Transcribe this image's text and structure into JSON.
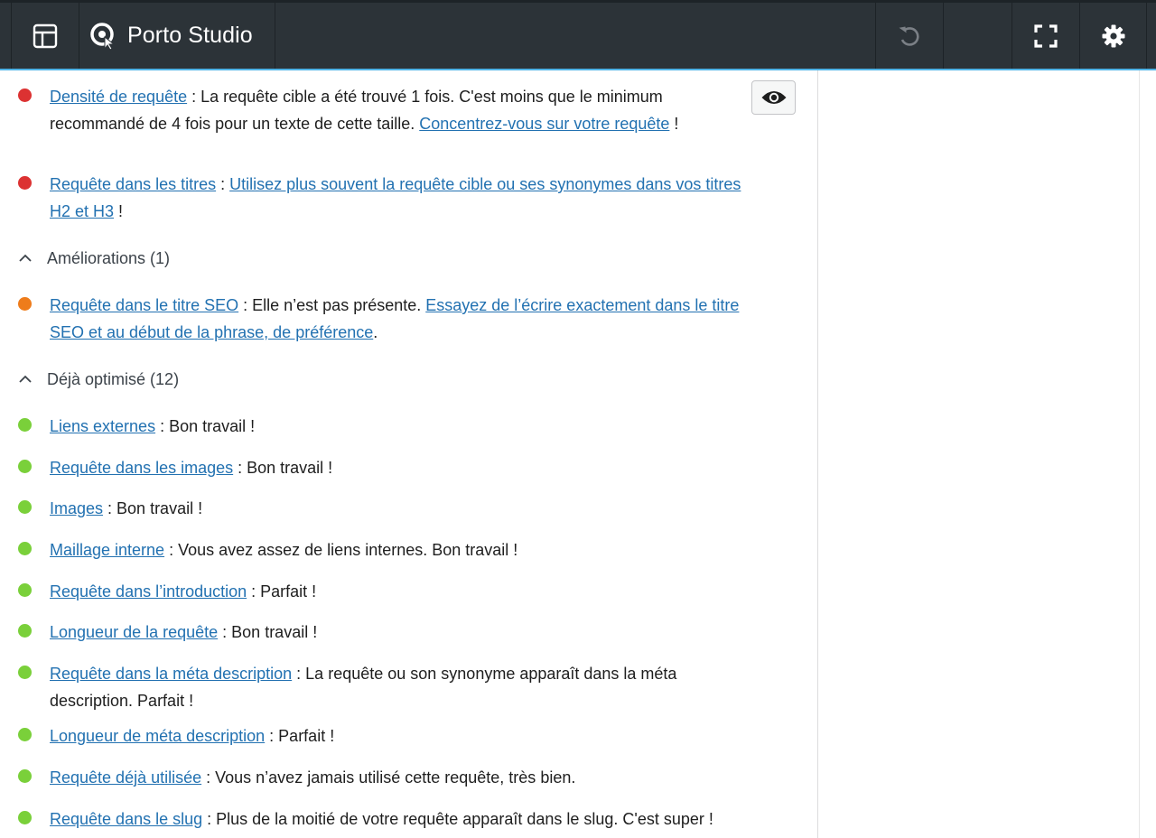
{
  "app": {
    "brand": "Porto Studio"
  },
  "toolbar": {
    "layout_icon": "layout-icon",
    "undo_icon": "undo-icon",
    "fullscreen_icon": "fullscreen-icon",
    "settings_icon": "gear-icon"
  },
  "colors": {
    "topbar_bg": "#2c3338",
    "accent_line": "#4fb3e6",
    "link": "#2271b1",
    "bad": "#dc3232",
    "ok": "#ee7c1b",
    "good": "#7ad03a"
  },
  "problems": [
    {
      "status": "bad",
      "link": "Densité de requête",
      "text": " : La requête cible a été trouvé 1 fois. C'est moins que le minimum recommandé de 4 fois pour un texte de cette taille. ",
      "link2": "Concentrez-vous sur votre requête",
      "tail": " !"
    },
    {
      "status": "bad",
      "link": "Requête dans les titres",
      "text": " : ",
      "link2": "Utilisez plus souvent la requête cible ou ses synonymes dans vos titres H2 et H3",
      "tail": " !"
    }
  ],
  "improvements": {
    "heading": "Améliorations (1)",
    "items": [
      {
        "status": "ok",
        "link": "Requête dans le titre SEO",
        "text": " : Elle n’est pas présente. ",
        "link2": "Essayez de l’écrire exactement dans le titre SEO et au début de la phrase, de préférence",
        "tail": "."
      }
    ]
  },
  "optimized": {
    "heading": "Déjà optimisé (12)",
    "items": [
      {
        "status": "good",
        "link": "Liens externes",
        "text": " : Bon travail !"
      },
      {
        "status": "good",
        "link": "Requête dans les images",
        "text": " : Bon travail !"
      },
      {
        "status": "good",
        "link": "Images",
        "text": " : Bon travail !"
      },
      {
        "status": "good",
        "link": "Maillage interne",
        "text": " : Vous avez assez de liens internes. Bon travail !"
      },
      {
        "status": "good",
        "link": "Requête dans l’introduction",
        "text": " : Parfait !"
      },
      {
        "status": "good",
        "link": "Longueur de la requête",
        "text": " : Bon travail !"
      },
      {
        "status": "good",
        "link": "Requête dans la méta description",
        "text": " : La requête ou son synonyme apparaît dans la méta description. Parfait !"
      },
      {
        "status": "good",
        "link": "Longueur de méta description",
        "text": " : Parfait !"
      },
      {
        "status": "good",
        "link": "Requête déjà utilisée",
        "text": " : Vous n’avez jamais utilisé cette requête, très bien."
      },
      {
        "status": "good",
        "link": "Requête dans le slug",
        "text": " : Plus de la moitié de votre requête apparaît dans le slug. C'est super !"
      }
    ]
  }
}
